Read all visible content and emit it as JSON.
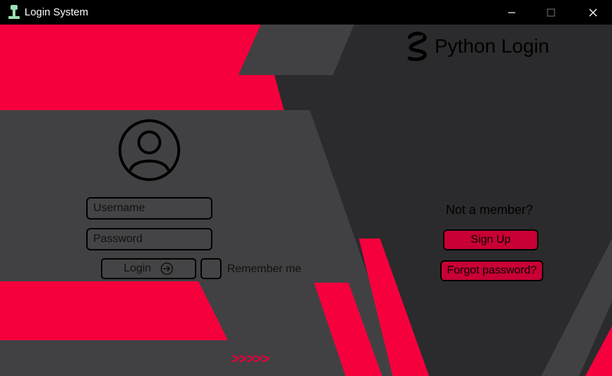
{
  "window": {
    "title": "Login System",
    "minimize_icon": "minimize-icon",
    "maximize_icon": "maximize-icon",
    "close_icon": "close-icon"
  },
  "brand": {
    "logo_icon": "python-snake-icon",
    "name": "Python Login"
  },
  "login_form": {
    "avatar_icon": "user-avatar-icon",
    "username": {
      "value": "",
      "placeholder": "Username"
    },
    "password": {
      "value": "",
      "placeholder": "Password"
    },
    "login_label": "Login",
    "login_icon": "sign-in-arrow-icon",
    "remember_label": "Remember me",
    "remember_checked": false,
    "decor_arrows": ">>>>>"
  },
  "side_panel": {
    "prompt": "Not a member?",
    "signup_label": "Sign Up",
    "forgot_label": "Forgot password?"
  },
  "colors": {
    "accent_red": "#f5003d",
    "button_red": "#c90035",
    "panel_gray": "#414143",
    "background_dark": "#2b2b2d",
    "titlebar": "#000000"
  }
}
